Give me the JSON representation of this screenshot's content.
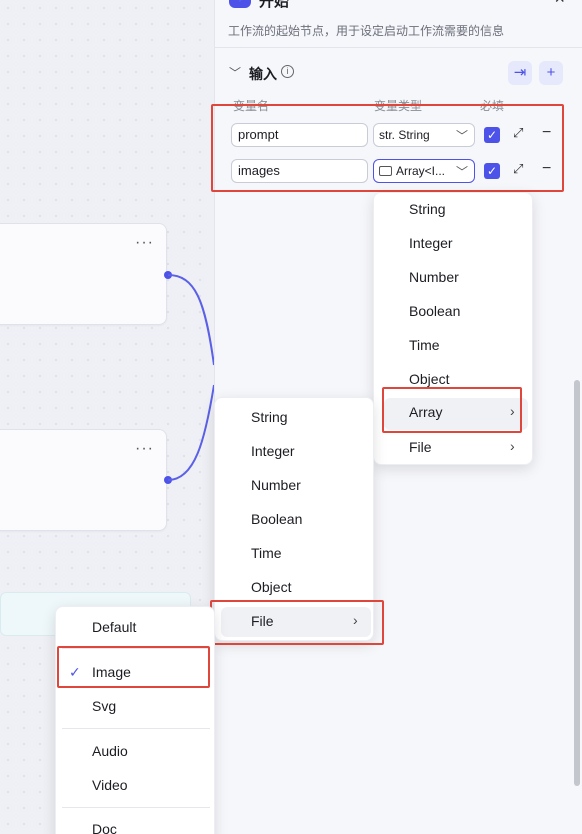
{
  "panel": {
    "title": "开始",
    "close_icon": "×",
    "description": "工作流的起始节点，用于设定启动工作流需要的信息",
    "input_section_title": "输入",
    "columns": {
      "name": "变量名",
      "type": "变量类型",
      "required": "必填"
    }
  },
  "variables": [
    {
      "name": "prompt",
      "type": "str. String",
      "required": true
    },
    {
      "name": "images",
      "type": "Array<I...",
      "required": true
    }
  ],
  "canvas": {
    "more_icon": "···"
  },
  "menus": {
    "type_menu": [
      "String",
      "Integer",
      "Number",
      "Boolean",
      "Time",
      "Object",
      "Array",
      "File"
    ],
    "array_sub_menu": [
      "String",
      "Integer",
      "Number",
      "Boolean",
      "Time",
      "Object",
      "File"
    ],
    "file_sub_menu": [
      "Default",
      "Image",
      "Svg",
      "Audio",
      "Video",
      "Doc"
    ],
    "selected_file_type": "Image"
  },
  "colors": {
    "accent": "#4d53e8",
    "highlight": "#e0473c"
  },
  "icons": {
    "start": "start-icon",
    "chevron_down": "chevron-down-icon",
    "info": "info-icon",
    "import": "import-icon",
    "add": "plus-icon",
    "expand": "expand-icon",
    "remove": "minus-icon",
    "checkmark": "check-icon",
    "chevron_right": "chevron-right-icon"
  }
}
